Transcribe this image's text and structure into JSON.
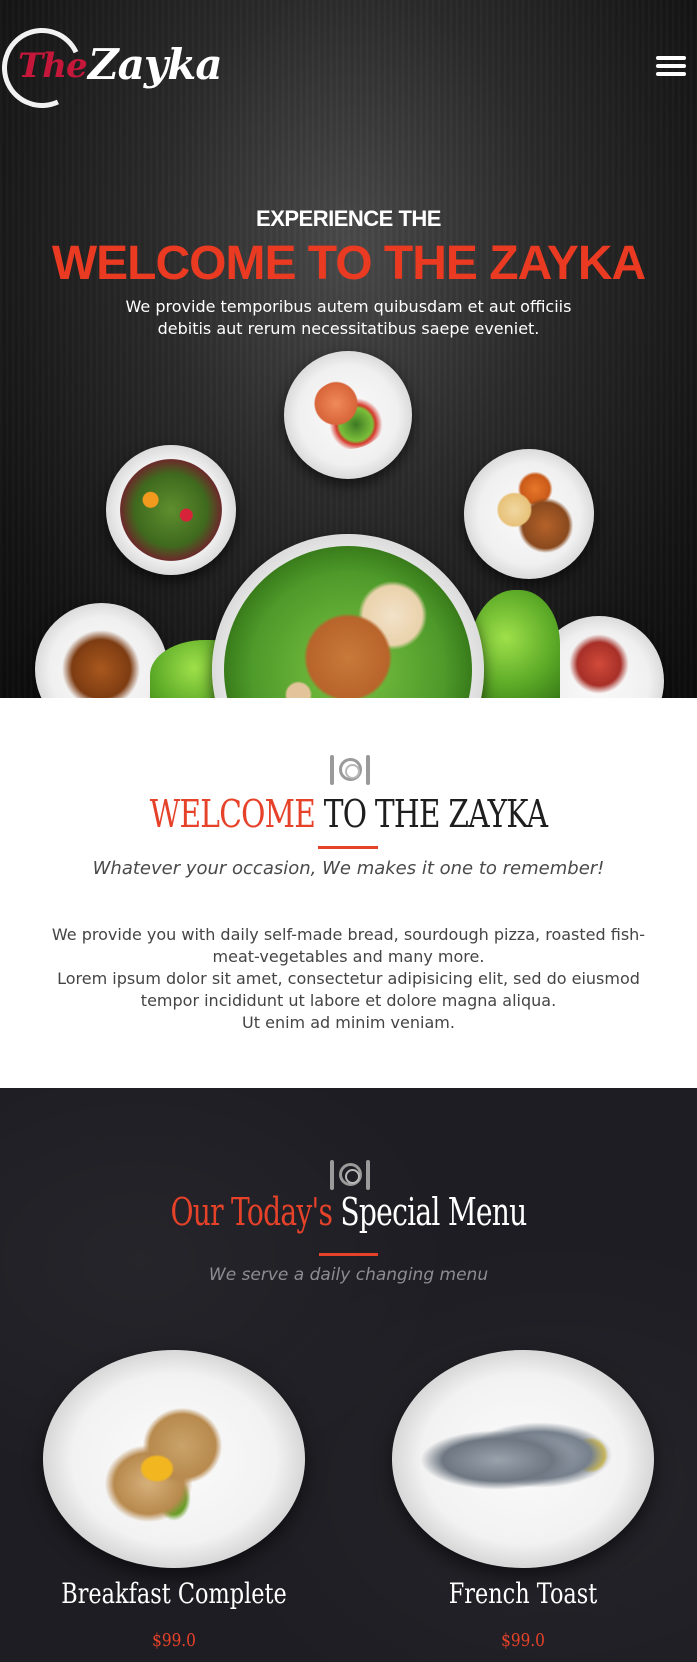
{
  "brand": {
    "logo_the": "The",
    "logo_name": "Zayka"
  },
  "nav": {
    "menu_icon": "hamburger-menu-icon"
  },
  "hero": {
    "eyebrow": "EXPERIENCE THE",
    "title": "WELCOME TO THE ZAYKA",
    "subtitle": "We provide temporibus autem quibusdam et aut officiis debitis aut rerum necessitatibus saepe eveniet."
  },
  "welcome": {
    "icon": "cutlery-plate-icon",
    "title_accent": "WELCOME",
    "title_rest": " TO THE ZAYKA",
    "tagline": "Whatever your occasion, We makes it one to remember!",
    "body_line1": "We provide you with daily self-made bread, sourdough pizza, roasted fish-meat-vegetables and many more.",
    "body_line2": "Lorem ipsum dolor sit amet, consectetur adipisicing elit, sed do eiusmod tempor incididunt ut labore et dolore magna aliqua.",
    "body_line3": "Ut enim ad minim veniam."
  },
  "menu": {
    "icon": "cutlery-plate-icon",
    "title_accent": "Our Today's",
    "title_rest": " Special Menu",
    "tagline": "We serve a daily changing menu",
    "items": [
      {
        "name": "Breakfast Complete",
        "price": "$99.0"
      },
      {
        "name": "French Toast",
        "price": "$99.0"
      }
    ]
  },
  "colors": {
    "accent": "#e6422a",
    "hero_title": "#ea3a22",
    "logo_red": "#c4173a",
    "dark_bg": "#1d1d23"
  }
}
